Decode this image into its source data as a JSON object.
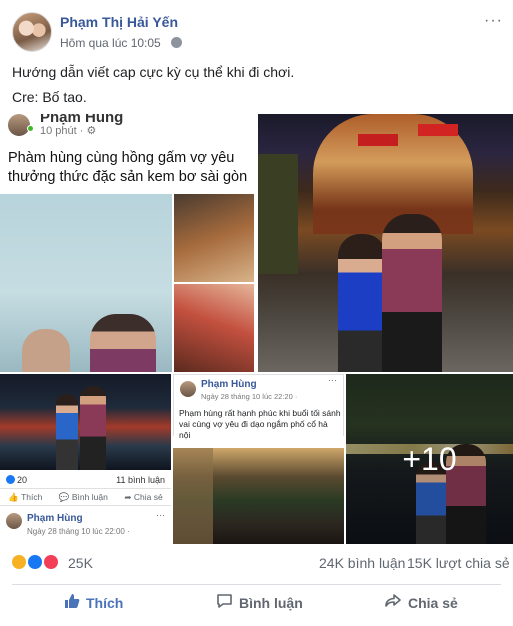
{
  "post": {
    "author": "Phạm Thị Hải Yến",
    "timestamp": "Hôm qua lúc 10:05",
    "privacy_icon": "globe-icon",
    "more_icon": "···",
    "caption_line1": "Hướng dẫn viết cap cực kỳ cụ thể khi đi chơi.",
    "caption_line2": "Cre: Bố tao."
  },
  "photos": {
    "tile1": {
      "name": "Phạm Hùng",
      "time": "10 phút · ",
      "text": "Phàm hùng cùng hồng gấm vợ yêu thưởng thức đặc sản kem bơ sài gòn"
    },
    "tile3": {
      "likes": "20",
      "comments": "11 bình luận",
      "like_label": "Thích",
      "comment_label": "Bình luận",
      "share_label": "Chia sẻ",
      "sub_name": "Phạm Hùng",
      "sub_time": "Ngày 28 tháng 10 lúc 22:00 · ",
      "sub_more": "···"
    },
    "tile4": {
      "name": "Phạm Hùng",
      "time": "Ngày 28 tháng 10 lúc 22:20 · ",
      "more": "···",
      "text": "Phạm hùng rất hạnh phúc khi buổi tối sánh vai cùng vợ yêu đi dạo ngắm phố cổ hà nội"
    },
    "tile5": {
      "more_count": "+10"
    }
  },
  "reactions": {
    "count": "25K",
    "comments": "24K bình luận",
    "shares": "15K lượt chia sẻ"
  },
  "actions": {
    "like": "Thích",
    "comment": "Bình luận",
    "share": "Chia sẻ"
  },
  "colors": {
    "link": "#385898",
    "like_active": "#4b73b9",
    "muted": "#606770"
  }
}
